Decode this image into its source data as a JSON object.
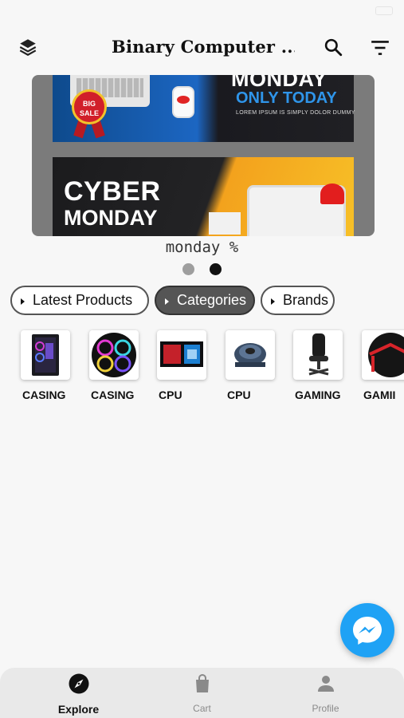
{
  "app": {
    "title": "Binary Computer ...",
    "icons": {
      "menu": "layers-icon",
      "search": "search-icon",
      "filter": "filter-icon"
    }
  },
  "banner": {
    "top_card": {
      "badge": "BIG SALE",
      "title": "MONDAY",
      "subtitle": "ONLY TODAY",
      "small_text": "LOREM IPSUM IS SIMPLY DOLOR DUMMY"
    },
    "bottom_card": {
      "line1": "CYBER",
      "line2": "MONDAY"
    },
    "caption": "monday %",
    "pages": 2,
    "active_page": 2
  },
  "chips": [
    {
      "label": "Latest Products",
      "active": false
    },
    {
      "label": "Categories",
      "active": true
    },
    {
      "label": "Brands",
      "active": false
    }
  ],
  "categories": [
    {
      "label": "CASING",
      "icon": "pc-case-image"
    },
    {
      "label": "CASING",
      "icon": "rgb-fans-image"
    },
    {
      "label": "CPU",
      "icon": "cpu-box-image"
    },
    {
      "label": "CPU",
      "icon": "cpu-cooler-image"
    },
    {
      "label": "GAMING",
      "icon": "gaming-chair-image"
    },
    {
      "label": "GAMII",
      "icon": "gaming-desk-image"
    }
  ],
  "fab": {
    "icon": "messenger-icon"
  },
  "tabs": [
    {
      "label": "Explore",
      "icon": "compass-icon",
      "active": true
    },
    {
      "label": "Cart",
      "icon": "shopping-bag-icon",
      "active": false
    },
    {
      "label": "Profile",
      "icon": "person-icon",
      "active": false
    }
  ],
  "colors": {
    "accent": "#1fa2f5",
    "chip_active": "#555555",
    "tab_bar": "#e9e9e9"
  }
}
